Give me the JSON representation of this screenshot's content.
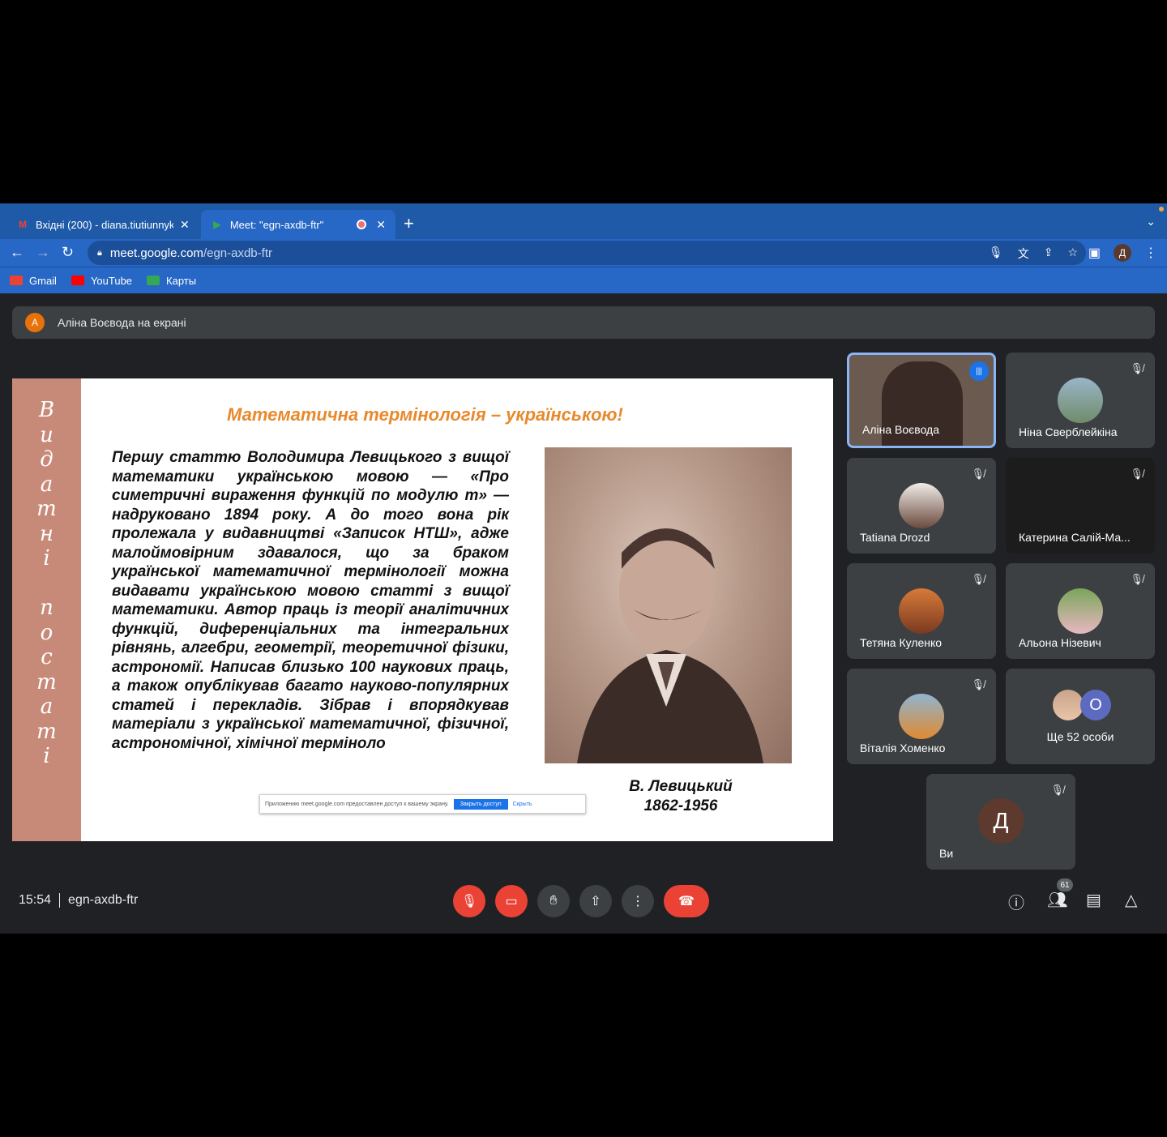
{
  "browser": {
    "tabs": [
      {
        "label": "Вхідні (200) - diana.tiutiunnyk",
        "favicon": "M"
      },
      {
        "label": "Meet: \"egn-axdb-ftr\"",
        "favicon": "▶"
      }
    ],
    "new_tab": "+",
    "url_domain": "meet.google.com",
    "url_path": "/egn-axdb-ftr",
    "profile_initial": "Д",
    "bookmarks": [
      {
        "label": "Gmail",
        "color": "#ea4335"
      },
      {
        "label": "YouTube",
        "color": "#ff0000"
      },
      {
        "label": "Карты",
        "color": "#34a853"
      }
    ]
  },
  "meet": {
    "presenter": {
      "initial": "А",
      "text": "Аліна Воєвода на екрані"
    },
    "slide": {
      "stripe_text": [
        "В",
        "и",
        "д",
        "а",
        "т",
        "н",
        "і",
        "",
        "п",
        "о",
        "с",
        "т",
        "а",
        "т",
        "і"
      ],
      "title": "Математична термінологія – українською!",
      "paragraph": "Першу статтю Володимира Левицького з вищої математики українською мовою — «Про симетричні вираження функцій по модулю m» — надруковано 1894 року. А до того вона рік пролежала у видавництві «Записок НТШ», адже малоймовірним здавалося, що за браком української математичної термінології можна видавати українською мовою статті з вищої математики. Автор праць із теорії аналітичних функцій, диференціальних та інтегральних рівнянь, алгебри, геометрії, теоретичної фізики, астрономії. Написав близько 100 наукових праць, а також опублікував багато науково-популярних статей і перекладів. Зібрав і впорядкував матеріали з української математичної, фізичної, астрономічної, хімічної терміноло",
      "caption_name": "В. Левицький",
      "caption_years": "1862-1956",
      "notice_text": "Приложению meet.google.com предоставлен доступ к вашему экрану.",
      "notice_stop": "Закрыть доступ",
      "notice_hide": "Скрыть"
    },
    "participants": [
      {
        "name": "Аліна Воєвода",
        "speaking": true
      },
      {
        "name": "Ніна Сверблейкіна"
      },
      {
        "name": "Tatiana Drozd"
      },
      {
        "name": "Катерина Салій-Ма..."
      },
      {
        "name": "Тетяна Куленко"
      },
      {
        "name": "Альона Нізевич"
      },
      {
        "name": "Віталія Хоменко"
      }
    ],
    "more": {
      "initial": "О",
      "label": "Ще 52 особи"
    },
    "you": {
      "initial": "Д",
      "label": "Ви"
    },
    "time": "15:54",
    "meeting_code": "egn-axdb-ftr",
    "participant_count": "61"
  }
}
